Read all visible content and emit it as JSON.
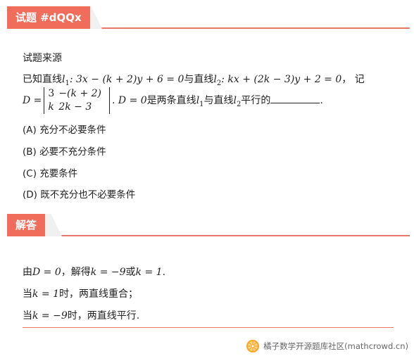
{
  "section1": {
    "title": "试题 #dQQx"
  },
  "problem": {
    "source_label": "试题来源",
    "stem_prefix": "已知直线",
    "l1": "l",
    "l1_sub": "1",
    "l1_eq": ": 3x − (k + 2)y + 6 = 0",
    "middle": "与直线",
    "l2": "l",
    "l2_sub": "2",
    "l2_eq": ": kx + (2k − 3)y + 2 = 0",
    "tail": "，  记",
    "D_label": "D =",
    "det": [
      [
        "3",
        "−(k + 2)"
      ],
      [
        "k",
        "2k − 3"
      ]
    ],
    "after_det": ". D = 0",
    "stem_end_a": "是两条直线",
    "stem_end_b": "与直线",
    "stem_end_c": "平行的",
    "stem_end_d": ".",
    "options": [
      {
        "label": "(A)",
        "text": "充分不必要条件"
      },
      {
        "label": "(B)",
        "text": "必要不充分条件"
      },
      {
        "label": "(C)",
        "text": "充要条件"
      },
      {
        "label": "(D)",
        "text": "既不充分也不必要条件"
      }
    ]
  },
  "section2": {
    "title": "解答"
  },
  "solution": {
    "line1_a": "由",
    "line1_b": "D = 0",
    "line1_c": "，解得",
    "line1_d": "k = −9",
    "line1_e": "或",
    "line1_f": "k = 1",
    "line1_g": ".",
    "line2_a": "当",
    "line2_b": "k = 1",
    "line2_c": "时，两直线重合；",
    "line3_a": "当",
    "line3_b": "k = −9",
    "line3_c": "时，两直线平行."
  },
  "footer": {
    "text": "橘子数学开源题库社区(mathcrowd.cn)",
    "logo_icon": "orange-slice-icon",
    "logo_color": "#f5a623"
  }
}
